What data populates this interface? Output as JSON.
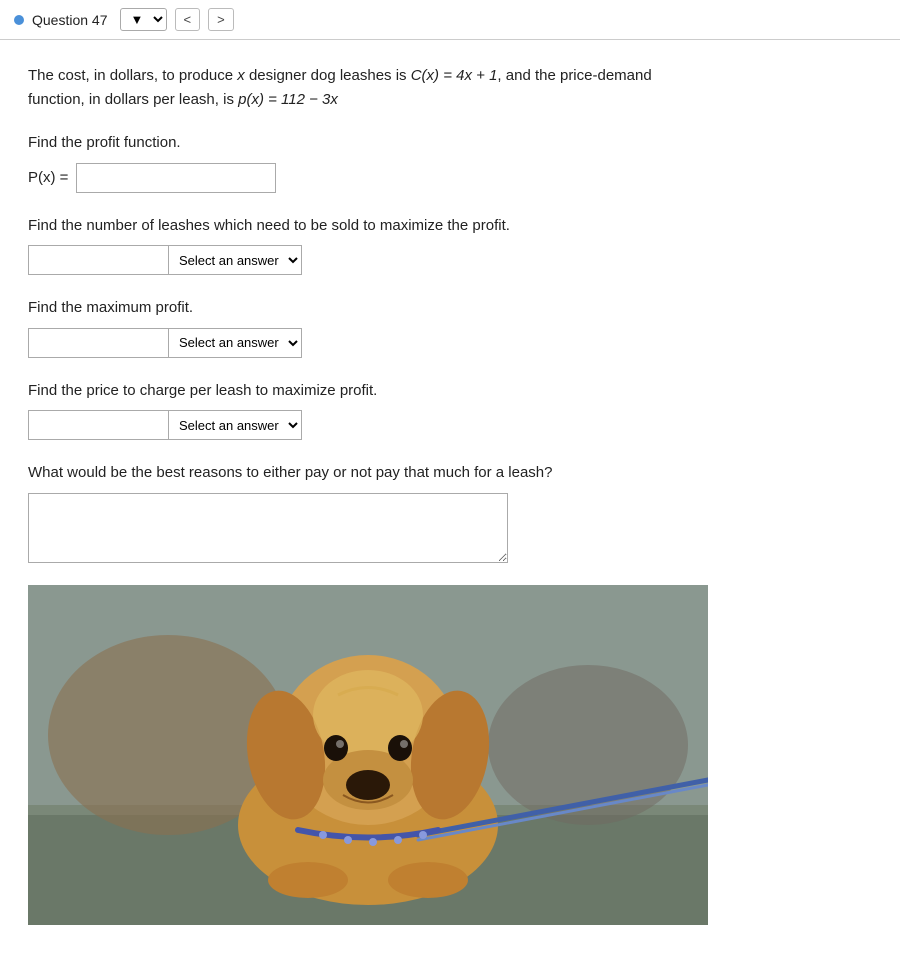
{
  "topbar": {
    "question_label": "Question 47",
    "nav_dropdown_symbol": "▼",
    "prev_btn": "<",
    "next_btn": ">"
  },
  "problem": {
    "description": "The cost, in dollars, to produce x designer dog leashes is C(x) = 4x + 1, and the price-demand function, in dollars per leash, is p(x) = 112 − 3x",
    "section1": {
      "label": "Find the profit function.",
      "prefix": "P(x) =",
      "placeholder": ""
    },
    "section2": {
      "label": "Find the number of leashes which need to be sold to maximize the profit.",
      "select_placeholder": "Select an answer"
    },
    "section3": {
      "label": "Find the maximum profit.",
      "select_placeholder": "Select an answer"
    },
    "section4": {
      "label": "Find the price to charge per leash to maximize profit.",
      "select_placeholder": "Select an answer"
    },
    "section5": {
      "label": "What would be the best reasons to either pay or not pay that much for a leash?",
      "placeholder": ""
    }
  }
}
